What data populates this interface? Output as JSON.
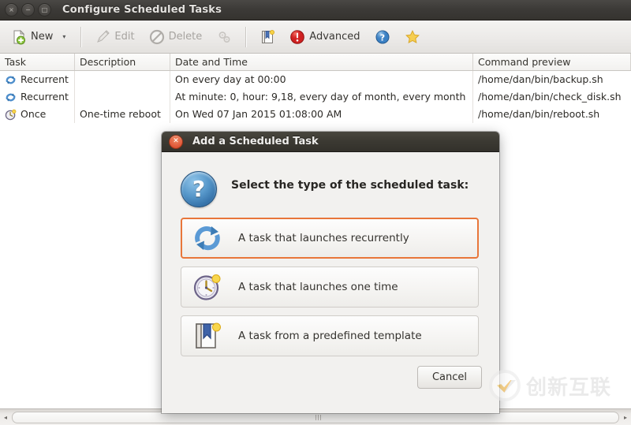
{
  "window": {
    "title": "Configure Scheduled Tasks",
    "controls": [
      {
        "name": "close",
        "glyph": "×"
      },
      {
        "name": "minimize",
        "glyph": "−"
      },
      {
        "name": "maximize",
        "glyph": "□"
      }
    ]
  },
  "toolbar": {
    "new_label": "New",
    "new_caret": "▾",
    "edit_label": "Edit",
    "delete_label": "Delete",
    "advanced_label": "Advanced",
    "icons": {
      "new": "new-document-icon",
      "edit": "pencil-icon",
      "delete": "no-entry-icon",
      "settings": "gears-icon",
      "template": "bookmark-book-icon",
      "advanced": "red-alert-icon",
      "help": "blue-question-icon",
      "favorite": "star-icon"
    }
  },
  "table": {
    "columns": [
      {
        "key": "task",
        "label": "Task"
      },
      {
        "key": "description",
        "label": "Description"
      },
      {
        "key": "datetime",
        "label": "Date and Time"
      },
      {
        "key": "command",
        "label": "Command preview"
      }
    ],
    "rows": [
      {
        "icon": "recurrent-icon",
        "task": "Recurrent",
        "description": "",
        "datetime": "On every day at 00:00",
        "command": "/home/dan/bin/backup.sh"
      },
      {
        "icon": "recurrent-icon",
        "task": "Recurrent",
        "description": "",
        "datetime": "At minute: 0, hour: 9,18, every day of month, every month",
        "command": "/home/dan/bin/check_disk.sh"
      },
      {
        "icon": "once-clock-icon",
        "task": "Once",
        "description": "One-time reboot",
        "datetime": "On Wed 07 Jan 2015 01:08:00 AM",
        "command": "/home/dan/bin/reboot.sh"
      }
    ]
  },
  "dialog": {
    "title": "Add a Scheduled Task",
    "close_glyph": "✕",
    "question_glyph": "?",
    "prompt": "Select the type of the scheduled task:",
    "options": [
      {
        "icon": "recurrent-arrows-icon",
        "label": "A task that launches recurrently",
        "selected": true
      },
      {
        "icon": "clock-icon",
        "label": "A task that launches one time",
        "selected": false
      },
      {
        "icon": "template-book-icon",
        "label": "A task from a predefined template",
        "selected": false
      }
    ],
    "cancel_label": "Cancel"
  },
  "scrollbar": {
    "left_arrow": "◂",
    "right_arrow": "▸"
  },
  "watermark": {
    "text": "创新互联"
  },
  "colors": {
    "titlebar": "#3b3933",
    "accent_selected": "#e8763a",
    "alert_red": "#cc2222",
    "help_blue": "#3a7fc1",
    "star_yellow": "#f3c53f"
  }
}
